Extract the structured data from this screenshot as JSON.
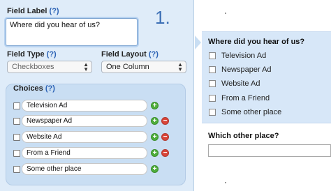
{
  "settings": {
    "field_label_title": "Field Label",
    "help": "(?)",
    "field_label_value": "Where did you hear of us?",
    "step_number": "1.",
    "field_type_title": "Field Type",
    "field_type_value": "Checkboxes",
    "field_layout_title": "Field Layout",
    "field_layout_value": "One Column",
    "choices_title": "Choices",
    "choices": [
      {
        "label": "Television Ad",
        "removable": false
      },
      {
        "label": "Newspaper Ad",
        "removable": true
      },
      {
        "label": "Website Ad",
        "removable": true
      },
      {
        "label": "From a Friend",
        "removable": true
      },
      {
        "label": "Some other place",
        "removable": false
      }
    ],
    "add_symbol": "+",
    "remove_symbol": "−"
  },
  "preview": {
    "question": "Where did you hear of us?",
    "options": [
      "Television Ad",
      "Newspaper Ad",
      "Website Ad",
      "From a Friend",
      "Some other place"
    ],
    "followup_question": "Which other place?"
  },
  "colors": {
    "panel_bg": "#dfecf9",
    "choices_bg": "#c9def3",
    "help_link": "#2b62b5",
    "step_number": "#3c6fb5",
    "add_button": "#4fae3c",
    "remove_button": "#d9463a"
  }
}
